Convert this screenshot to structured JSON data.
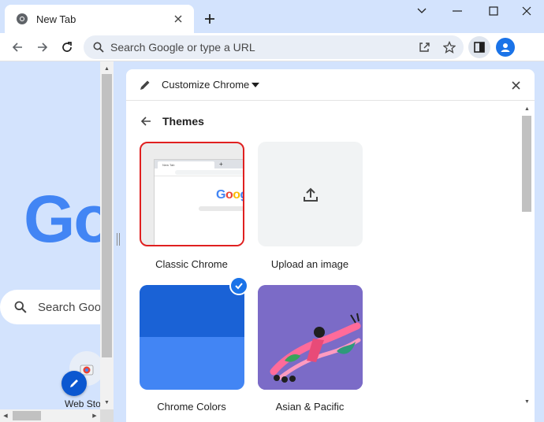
{
  "window": {
    "tab_title": "New Tab",
    "new_tab_symbol": "+"
  },
  "toolbar": {
    "omnibox_placeholder": "Search Google or type a URL"
  },
  "ntp": {
    "logo_text": "Go",
    "search_text": "Search Goo",
    "shortcut_label": "Web Sto"
  },
  "panel": {
    "header_title": "Customize Chrome",
    "section_title": "Themes",
    "tiles": [
      {
        "label": "Classic Chrome",
        "selected_outline": true
      },
      {
        "label": "Upload an image"
      },
      {
        "label": "Chrome Colors",
        "checked": true
      },
      {
        "label": "Asian & Pacific"
      }
    ],
    "mini_preview": {
      "tab_label": "New Tab",
      "logo": "Goog"
    }
  },
  "colors": {
    "accent": "#1a73e8",
    "selection_outline": "#e02020",
    "ntp_background": "#d3e3fd"
  },
  "icons": [
    "chrome-icon",
    "close-icon",
    "plus-icon",
    "minimize-icon",
    "restore-icon",
    "maximize-icon",
    "back-icon",
    "forward-icon",
    "reload-icon",
    "search-icon",
    "share-icon",
    "star-icon",
    "side-panel-icon",
    "profile-icon",
    "pencil-icon",
    "dropdown-icon",
    "upload-icon",
    "check-icon"
  ]
}
